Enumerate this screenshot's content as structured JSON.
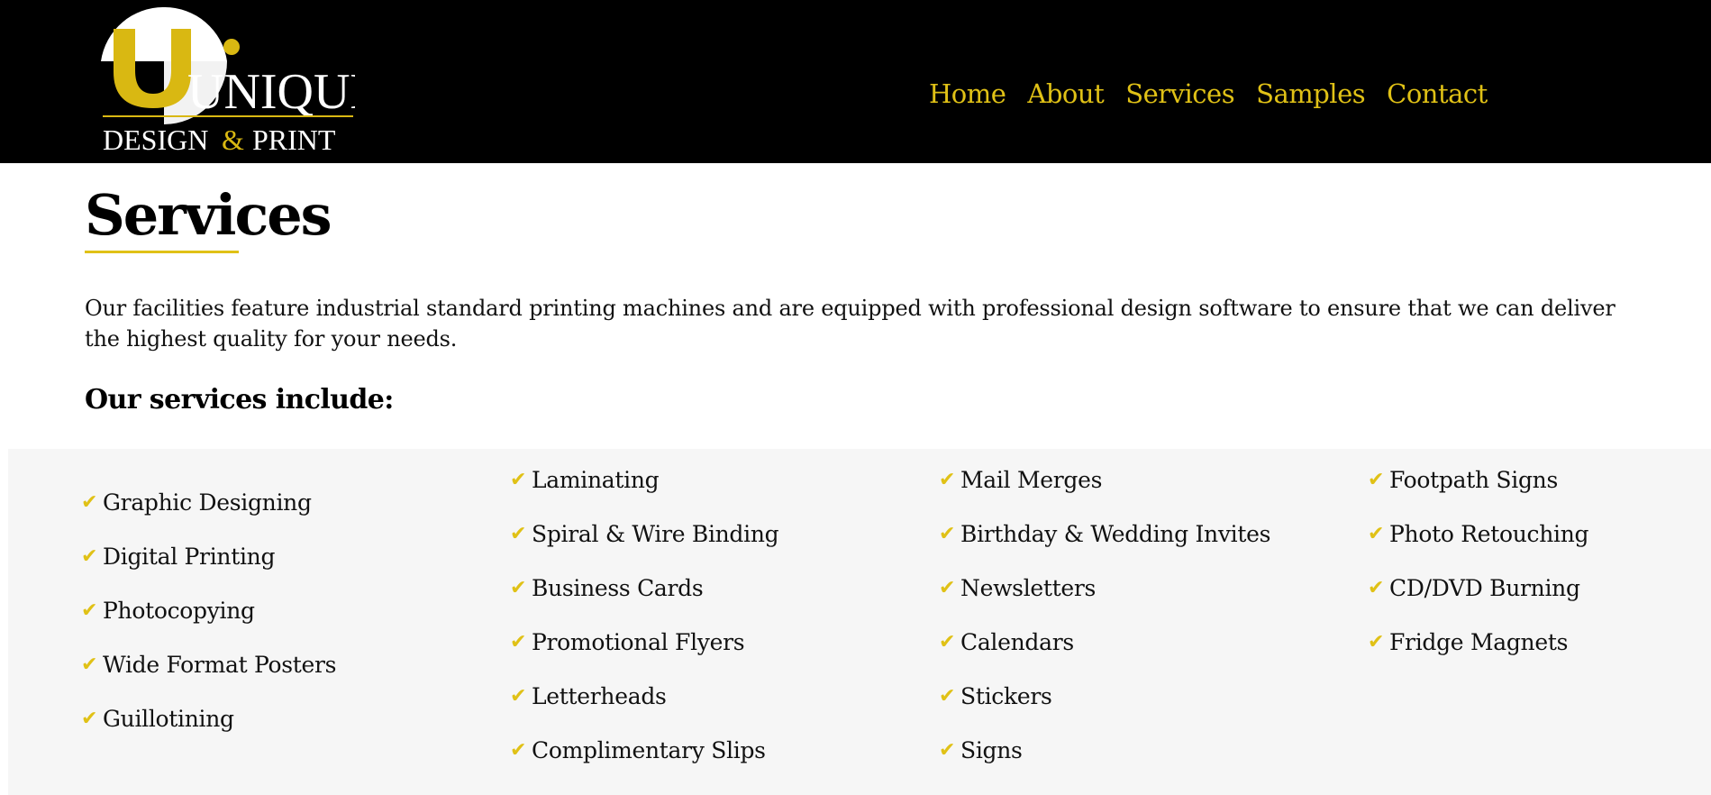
{
  "logo": {
    "name": "UNIQUE",
    "tagline_part1": "DESIGN",
    "tagline_amp": "&",
    "tagline_part2": "PRINT"
  },
  "nav": {
    "items": [
      "Home",
      "About",
      "Services",
      "Samples",
      "Contact"
    ]
  },
  "page": {
    "title": "Services",
    "intro": "Our facilities feature industrial standard printing machines and are equipped with professional design software to ensure that we can deliver the highest quality for your needs.",
    "subhead": "Our services include:"
  },
  "services": {
    "check_glyph": "✔",
    "col1": [
      "Graphic Designing",
      "Digital Printing",
      "Photocopying",
      "Wide Format Posters",
      "Guillotining"
    ],
    "col2": [
      "Laminating",
      "Spiral & Wire Binding",
      "Business Cards",
      "Promotional Flyers",
      "Letterheads",
      "Complimentary Slips"
    ],
    "col3": [
      "Mail Merges",
      "Birthday & Wedding Invites",
      "Newsletters",
      "Calendars",
      "Stickers",
      "Signs"
    ],
    "col4": [
      "Footpath Signs",
      "Photo Retouching",
      "CD/DVD Burning",
      "Fridge Magnets"
    ]
  },
  "colors": {
    "accent": "#e0c116",
    "header_bg": "#000000",
    "panel_bg": "#f6f6f6"
  },
  "icons": {
    "check": "check-icon",
    "logo": "unique-logo-icon"
  }
}
